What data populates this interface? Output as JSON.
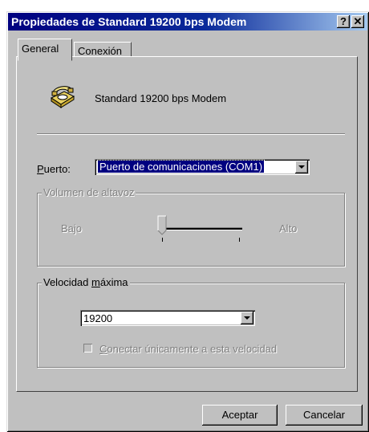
{
  "window": {
    "title": "Propiedades de Standard 19200 bps Modem",
    "help_button": "?",
    "close_button": "✕"
  },
  "tabs": [
    {
      "label": "General",
      "active": true
    },
    {
      "label": "Conexión",
      "active": false
    }
  ],
  "device": {
    "name": "Standard 19200 bps Modem",
    "icon": "phone-modem-icon"
  },
  "port": {
    "label_accel": "P",
    "label_rest": "uerto:",
    "value": "Puerto de comunicaciones (COM1)"
  },
  "volume": {
    "title": "Volumen de altavoz",
    "low_label": "Bajo",
    "high_label": "Alto",
    "level": 0.0,
    "enabled": false
  },
  "speed": {
    "title_pre": "Velocidad ",
    "title_accel": "m",
    "title_post": "áxima",
    "value": "19200",
    "only_this_speed_pre": "",
    "only_this_speed_accel": "C",
    "only_this_speed_rest": "onectar únicamente a esta velocidad",
    "only_this_speed_checked": false,
    "only_this_speed_enabled": false
  },
  "buttons": {
    "ok": "Aceptar",
    "cancel": "Cancelar"
  },
  "colors": {
    "title_bar_start": "#000080",
    "title_bar_end": "#a6caf0",
    "face": "#c0c0c0",
    "selection": "#000080"
  }
}
